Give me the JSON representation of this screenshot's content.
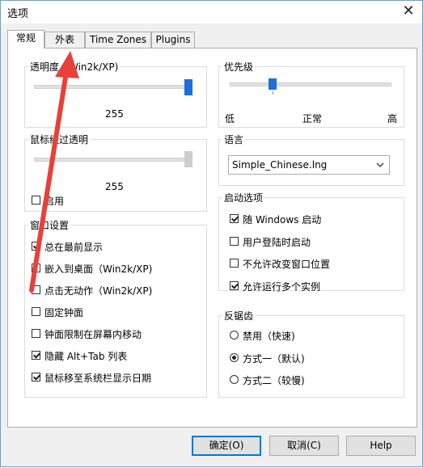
{
  "window": {
    "title": "选项",
    "close_glyph": "✕"
  },
  "tabs": [
    {
      "label": "常规",
      "active": true
    },
    {
      "label": "外表",
      "active": false
    },
    {
      "label": "Time Zones",
      "active": false
    },
    {
      "label": "Plugins",
      "active": false
    }
  ],
  "transparency": {
    "legend": "透明度（Win2k/XP)",
    "value_text": "255",
    "level": 1.0
  },
  "hover_transparency": {
    "legend": "鼠标经过透明",
    "value_text": "255",
    "level": 1.0,
    "enable_label": "启用",
    "enable_checked": false
  },
  "window_settings": {
    "legend": "窗口设置",
    "items": [
      {
        "label": "总在最前显示",
        "checked": true
      },
      {
        "label": "嵌入到桌面（Win2k/XP)",
        "checked": false
      },
      {
        "label": "点击无动作（Win2k/XP)",
        "checked": false
      },
      {
        "label": "固定钟面",
        "checked": false
      },
      {
        "label": "钟面限制在屏幕内移动",
        "checked": false
      },
      {
        "label": "隐藏 Alt+Tab 列表",
        "checked": true
      },
      {
        "label": "鼠标移至系统栏显示日期",
        "checked": true
      }
    ]
  },
  "priority": {
    "legend": "优先级",
    "low": "低",
    "normal": "正常",
    "high": "高",
    "level": 0.25
  },
  "language": {
    "legend": "语言",
    "selected": "Simple_Chinese.lng"
  },
  "startup": {
    "legend": "启动选项",
    "items": [
      {
        "label": "随 Windows 启动",
        "checked": true
      },
      {
        "label": "用户登陆时启动",
        "checked": false
      },
      {
        "label": "不允许改变窗口位置",
        "checked": false
      },
      {
        "label": "允许运行多个实例",
        "checked": true
      }
    ]
  },
  "antialias": {
    "legend": "反锯齿",
    "options": [
      {
        "label": "禁用（快速)",
        "selected": false
      },
      {
        "label": "方式一（默认)",
        "selected": true
      },
      {
        "label": "方式二（较慢)",
        "selected": false
      }
    ]
  },
  "buttons": {
    "ok": "确定(O)",
    "cancel": "取消(C)",
    "help": "Help"
  },
  "colors": {
    "accent": "#0078d7",
    "annotation": "#e8403a"
  }
}
